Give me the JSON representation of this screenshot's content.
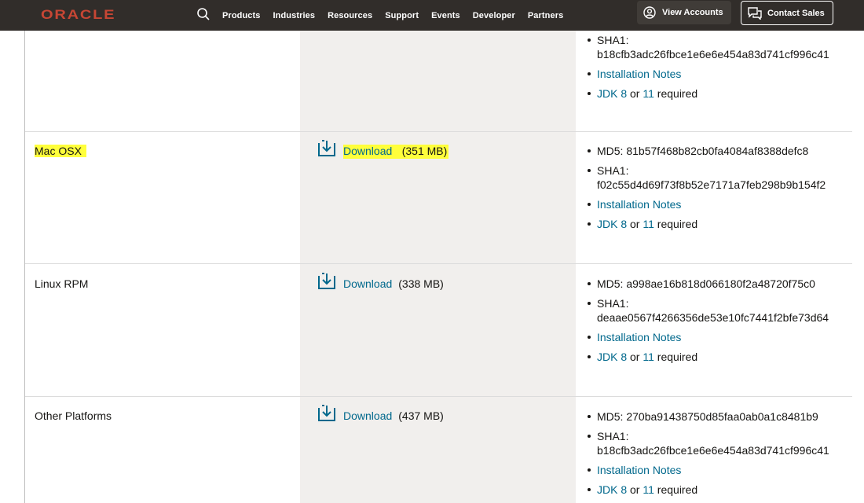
{
  "header": {
    "logo": "ORACLE",
    "nav": [
      "Products",
      "Industries",
      "Resources",
      "Support",
      "Events",
      "Developer",
      "Partners"
    ],
    "view_accounts": "View Accounts",
    "contact_sales": "Contact Sales"
  },
  "colors": {
    "header_bg": "#312d2a",
    "brand_red": "#c74634",
    "link": "#00688c",
    "highlight": "#ffff3b",
    "mid_column_bg": "#f1efed"
  },
  "rows": [
    {
      "platform": "",
      "download_label": "",
      "size": "",
      "sha1_label": "SHA1:",
      "sha1": "b18cfb3adc26fbce1e6e6e454a83d741cf996c41",
      "install_notes": "Installation Notes",
      "jdk_a": "JDK 8",
      "or": "or",
      "jdk_b": "11",
      "required": "required"
    },
    {
      "platform": "Mac OSX",
      "download_label": "Download",
      "size": "(351 MB)",
      "md5": "MD5: 81b57f468b82cb0fa4084af8388defc8",
      "sha1_label": "SHA1:",
      "sha1": "f02c55d4d69f73f8b52e7171a7feb298b9b154f2",
      "install_notes": "Installation Notes",
      "jdk_a": "JDK 8",
      "or": "or",
      "jdk_b": "11",
      "required": "required"
    },
    {
      "platform": "Linux RPM",
      "download_label": "Download",
      "size": "(338 MB)",
      "md5": "MD5: a998ae16b818d066180f2a48720f75c0",
      "sha1_label": "SHA1:",
      "sha1": "deaae0567f4266356de53e10fc7441f2bfe73d64",
      "install_notes": "Installation Notes",
      "jdk_a": "JDK 8",
      "or": "or",
      "jdk_b": "11",
      "required": "required"
    },
    {
      "platform": "Other Platforms",
      "download_label": "Download",
      "size": "(437 MB)",
      "md5": "MD5: 270ba91438750d85faa0ab0a1c8481b9",
      "sha1_label": "SHA1:",
      "sha1": "b18cfb3adc26fbce1e6e6e454a83d741cf996c41",
      "install_notes": "Installation Notes",
      "jdk_a": "JDK 8",
      "or": "or",
      "jdk_b": "11",
      "required": "required"
    }
  ]
}
